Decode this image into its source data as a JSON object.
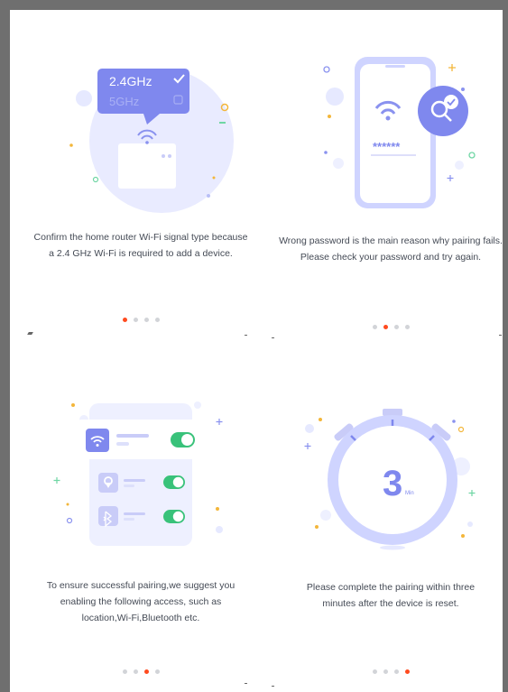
{
  "colors": {
    "accent": "#7f88ee",
    "soft_accent": "#e4e7ff",
    "active_dot": "#ff4b1f",
    "inactive_dot": "#d2d4d8",
    "toggle_on": "#39c27a",
    "caption_text": "#444a55",
    "border": "#6f6f6f"
  },
  "slides": [
    {
      "illustration": "wifi-router",
      "band_24": "2.4GHz",
      "band_5": "5GHz",
      "caption": "Confirm the home router Wi-Fi signal type because a 2.4 GHz Wi-Fi is required to add a device.",
      "active_dot": 0
    },
    {
      "illustration": "phone-password",
      "password_mask": "******",
      "caption": "Wrong password is the main reason why pairing fails. Please check your password and try again.",
      "active_dot": 1
    },
    {
      "illustration": "permissions-toggles",
      "toggles": [
        "wifi-icon",
        "location-icon",
        "bluetooth-icon"
      ],
      "caption": "To ensure successful pairing,we suggest you enabling the following access, such as location,Wi-Fi,Bluetooth etc.",
      "active_dot": 2
    },
    {
      "illustration": "stopwatch",
      "timer_value": "3",
      "timer_unit": "Min",
      "caption": "Please complete the pairing within three minutes after the device is reset.",
      "active_dot": 3
    }
  ]
}
